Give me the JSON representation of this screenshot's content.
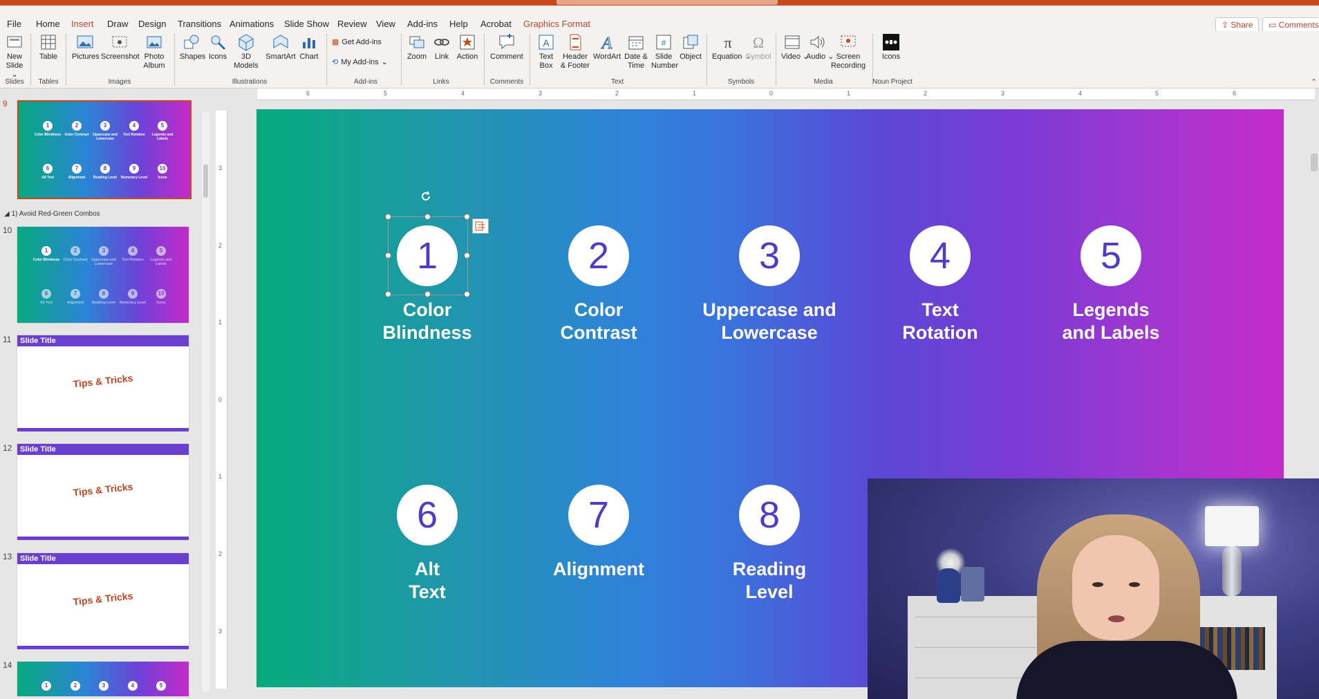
{
  "menu": {
    "tabs": [
      "File",
      "Home",
      "Insert",
      "Draw",
      "Design",
      "Transitions",
      "Animations",
      "Slide Show",
      "Review",
      "View",
      "Add-ins",
      "Help",
      "Acrobat",
      "Graphics Format"
    ],
    "active": "Insert",
    "share": "Share",
    "comments": "Comments"
  },
  "ribbon": {
    "buttons": {
      "new_slide": "New\nSlide",
      "table": "Table",
      "pictures": "Pictures",
      "screenshot": "Screenshot",
      "photo_album": "Photo\nAlbum",
      "shapes": "Shapes",
      "icons": "Icons",
      "models_3d": "3D\nModels",
      "smartart": "SmartArt",
      "chart": "Chart",
      "get_addins": "Get Add-ins",
      "my_addins": "My Add-ins",
      "zoom": "Zoom",
      "link": "Link",
      "action": "Action",
      "comment": "Comment",
      "text_box": "Text\nBox",
      "header_footer": "Header\n& Footer",
      "wordart": "WordArt",
      "date_time": "Date &\nTime",
      "slide_number": "Slide\nNumber",
      "object": "Object",
      "equation": "Equation",
      "symbol": "Symbol",
      "video": "Video",
      "audio": "Audio",
      "screen_recording": "Screen\nRecording",
      "noun_icons": "Icons"
    },
    "groups": [
      "Slides",
      "Tables",
      "Images",
      "Illustrations",
      "Add-ins",
      "Links",
      "Comments",
      "Text",
      "Symbols",
      "Media",
      "Noun Project"
    ]
  },
  "thumbnails": {
    "numbers": [
      "9",
      "10",
      "11",
      "12",
      "13",
      "14"
    ],
    "section": "1) Avoid Red-Green Combos",
    "slide_title": "Slide Title",
    "tips": "Tips & Tricks",
    "mini_labels": [
      "Color Blindness",
      "Color Contrast",
      "Uppercase and Lowercase",
      "Text Rotation",
      "Legends and Labels",
      "Alt Text",
      "Alignment",
      "Reading Level",
      "Numeracy Level",
      "Icons"
    ]
  },
  "slide": {
    "items": [
      {
        "num": "1",
        "label": "Color\nBlindness"
      },
      {
        "num": "2",
        "label": "Color\nContrast"
      },
      {
        "num": "3",
        "label": "Uppercase and\nLowercase"
      },
      {
        "num": "4",
        "label": "Text\nRotation"
      },
      {
        "num": "5",
        "label": "Legends\nand Labels"
      },
      {
        "num": "6",
        "label": "Alt\nText"
      },
      {
        "num": "7",
        "label": "Alignment"
      },
      {
        "num": "8",
        "label": "Reading\nLevel"
      }
    ]
  },
  "ruler": {
    "h": [
      "6",
      "5",
      "4",
      "3",
      "2",
      "1",
      "0",
      "1",
      "2",
      "3",
      "4",
      "5",
      "6"
    ],
    "v": [
      "3",
      "2",
      "1",
      "0",
      "1",
      "2",
      "3"
    ]
  },
  "colors": {
    "accent": "#b7472a",
    "titlebar": "#c5491d",
    "circle_text": "#4f3bc4"
  }
}
